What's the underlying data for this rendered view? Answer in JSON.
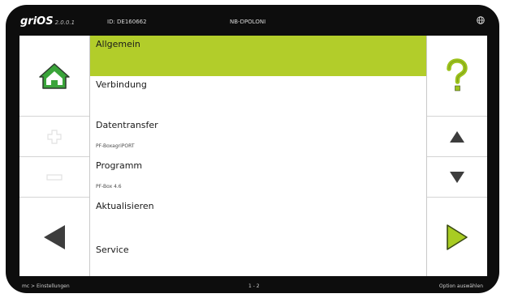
{
  "header": {
    "logo": "griOS",
    "version": "2.0.0.1",
    "serial": "ID: DE160662",
    "device_name": "NB-DPOLONI",
    "globe_icon": "globe-icon"
  },
  "left_panel": {
    "home_icon": "home-icon",
    "plus_icon": "plus-icon",
    "minus_icon": "minus-icon",
    "back_icon": "arrow-left-icon"
  },
  "right_panel": {
    "help_icon": "question-mark-icon",
    "up_icon": "arrow-up-icon",
    "down_icon": "arrow-down-icon",
    "next_icon": "arrow-right-icon"
  },
  "menu": {
    "items": [
      {
        "label": "Allgemein",
        "sub": "",
        "active": true
      },
      {
        "label": "Verbindung",
        "sub": "",
        "active": false
      },
      {
        "label": "Datentransfer",
        "sub": "PF-BoxagriPORT",
        "active": false
      },
      {
        "label": "Programm",
        "sub": "PF-Box 4.6",
        "active": false
      },
      {
        "label": "Aktualisieren",
        "sub": "",
        "active": false
      },
      {
        "label": "Service",
        "sub": "",
        "active": false
      }
    ]
  },
  "footer": {
    "breadcrumb": "mc > Einstellungen",
    "page": "1 - 2",
    "hint": "Option auswählen"
  },
  "colors": {
    "accent": "#b2cd2a",
    "home_green": "#3aa43a",
    "help_green": "#9cc21c",
    "next_green": "#a8cc22",
    "arrow_grey": "#3d3d3d",
    "device_black": "#0d0d0d"
  }
}
